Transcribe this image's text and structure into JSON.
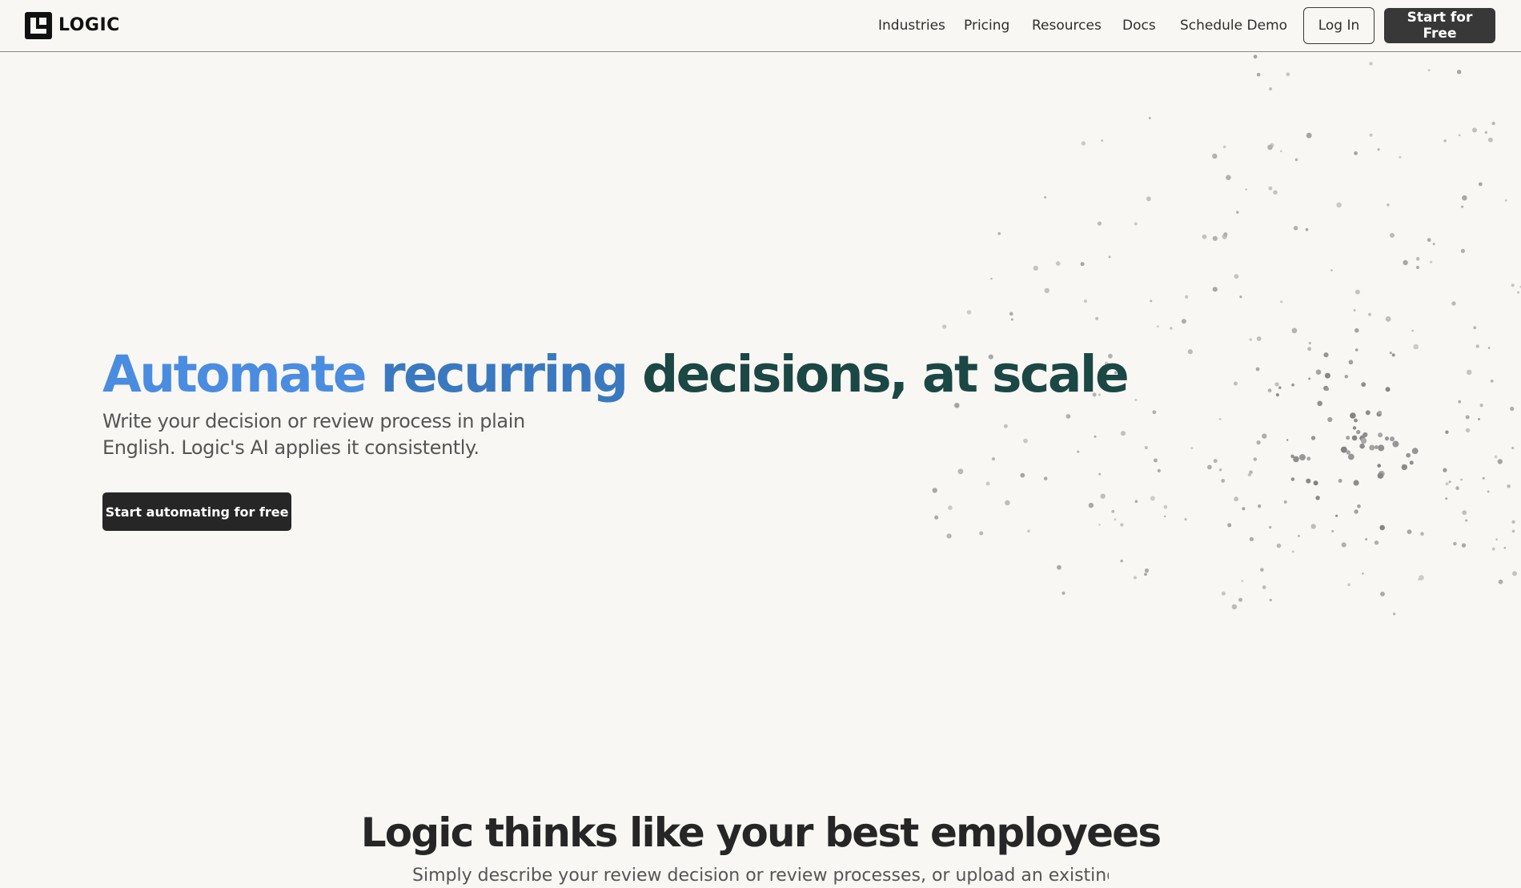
{
  "brand": {
    "name": "LOGIC",
    "logo_icon": "logic-logo-icon"
  },
  "nav": {
    "links": [
      {
        "label": "Industries"
      },
      {
        "label": "Pricing"
      },
      {
        "label": "Resources"
      },
      {
        "label": "Docs"
      },
      {
        "label": "Schedule Demo"
      }
    ],
    "login_label": "Log In",
    "start_label": "Start for Free"
  },
  "hero": {
    "title_part1": "Automate ",
    "title_part2": "recurring",
    "title_part3": " decisions, at scale",
    "subtitle": "Write your decision or review process in plain English. Logic's AI applies it consistently.",
    "cta_label": "Start automating for free"
  },
  "section2": {
    "title": "Logic thinks like your best employees",
    "subtitle": "Simply describe your review decision or review processes, or upload an existing SOP. The autod"
  },
  "colors": {
    "background": "#f8f7f3",
    "title_blue_light": "#4a8ce0",
    "title_blue_dark": "#3a79bf",
    "title_teal": "#1b4744",
    "button_dark": "#262626"
  }
}
